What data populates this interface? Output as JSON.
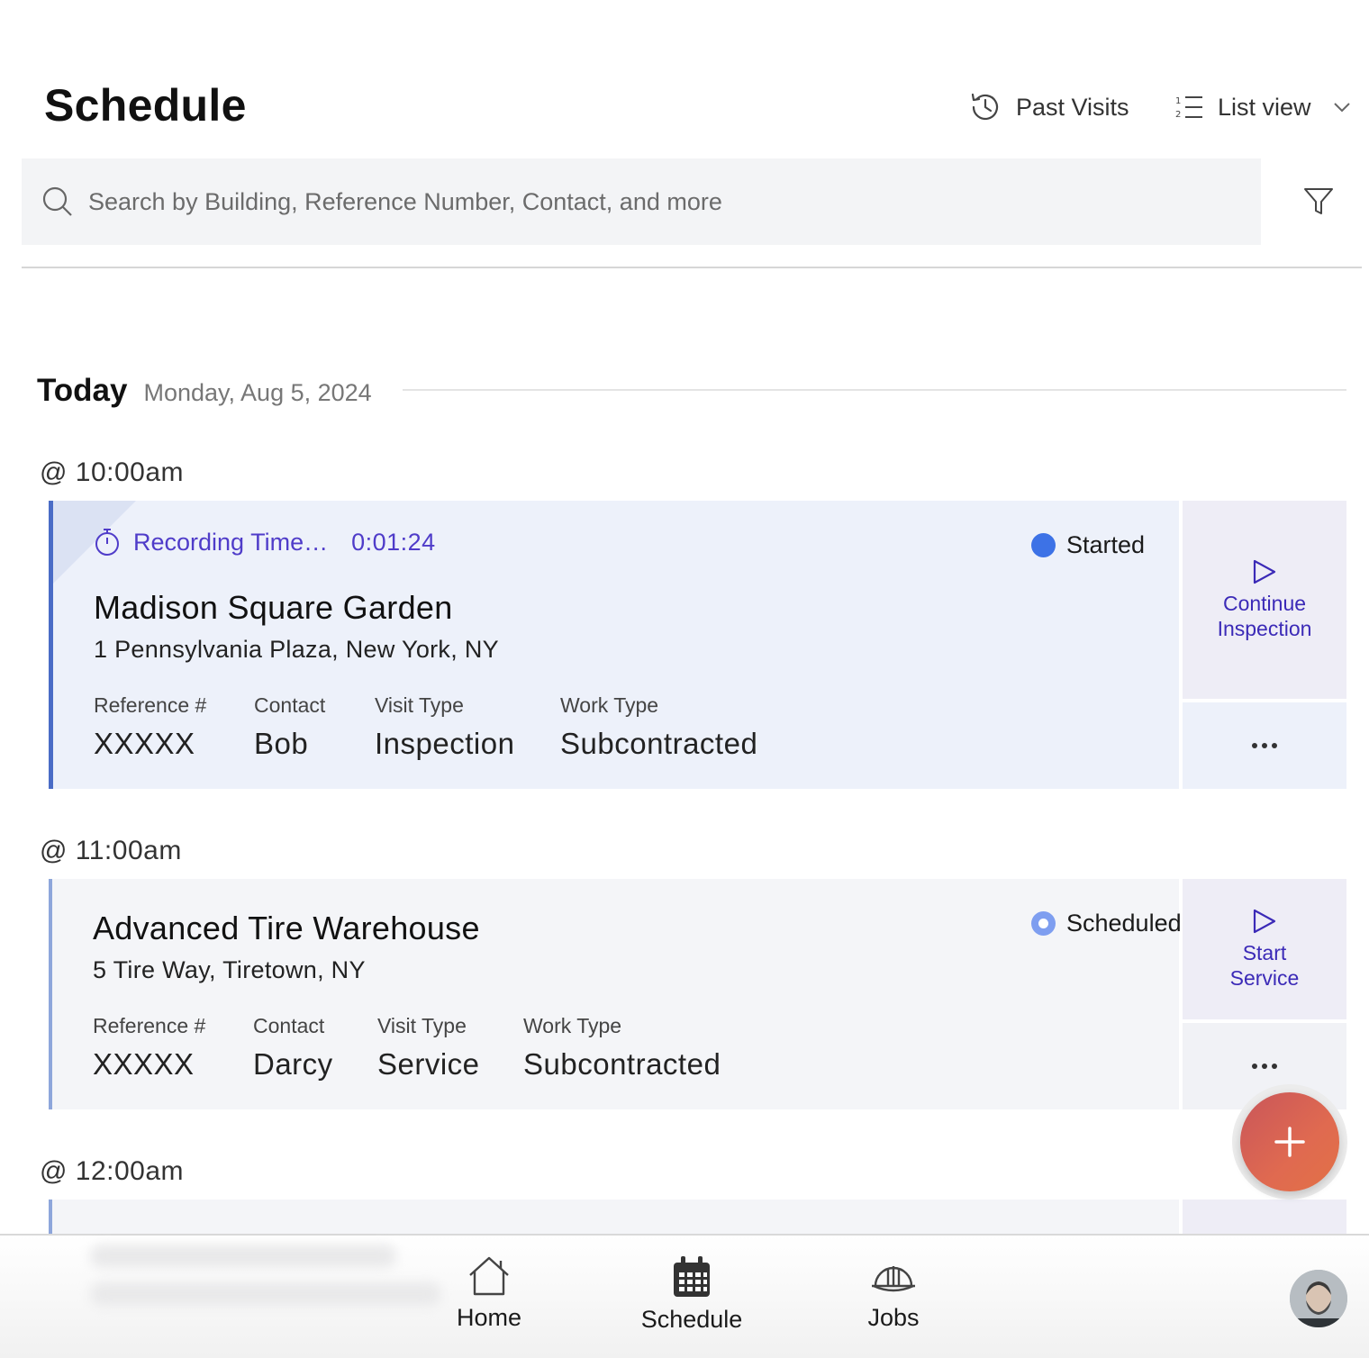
{
  "header": {
    "title": "Schedule",
    "past_visits_label": "Past Visits",
    "list_view_label": "List view"
  },
  "search": {
    "placeholder": "Search by Building, Reference Number, Contact, and more"
  },
  "day": {
    "label": "Today",
    "date": "Monday, Aug 5, 2024"
  },
  "visits": [
    {
      "time": "@ 10:00am",
      "recording_label": "Recording Time…",
      "recording_timer": "0:01:24",
      "status": "Started",
      "title": "Madison Square Garden",
      "address": "1 Pennsylvania Plaza, New York, NY",
      "reference_label": "Reference #",
      "reference_value": "XXXXX",
      "contact_label": "Contact",
      "contact_value": "Bob",
      "visit_type_label": "Visit Type",
      "visit_type_value": "Inspection",
      "work_type_label": "Work Type",
      "work_type_value": "Subcontracted",
      "action_line1": "Continue",
      "action_line2": "Inspection"
    },
    {
      "time": "@ 11:00am",
      "status": "Scheduled",
      "title": "Advanced Tire Warehouse",
      "address": "5 Tire Way, Tiretown, NY",
      "reference_label": "Reference #",
      "reference_value": "XXXXX",
      "contact_label": "Contact",
      "contact_value": "Darcy",
      "visit_type_label": "Visit Type",
      "visit_type_value": "Service",
      "work_type_label": "Work Type",
      "work_type_value": "Subcontracted",
      "action_line1": "Start",
      "action_line2": "Service"
    },
    {
      "time": "@ 12:00am"
    }
  ],
  "nav": {
    "items": [
      {
        "label": "Home",
        "icon": "home-icon"
      },
      {
        "label": "Schedule",
        "icon": "calendar-icon",
        "active": true
      },
      {
        "label": "Jobs",
        "icon": "hard-hat-icon"
      }
    ]
  },
  "colors": {
    "accent": "#4f3cc9",
    "started_dot": "#3d72e6",
    "scheduled_dot": "#7e9ef0",
    "fab": "#e06a50"
  }
}
